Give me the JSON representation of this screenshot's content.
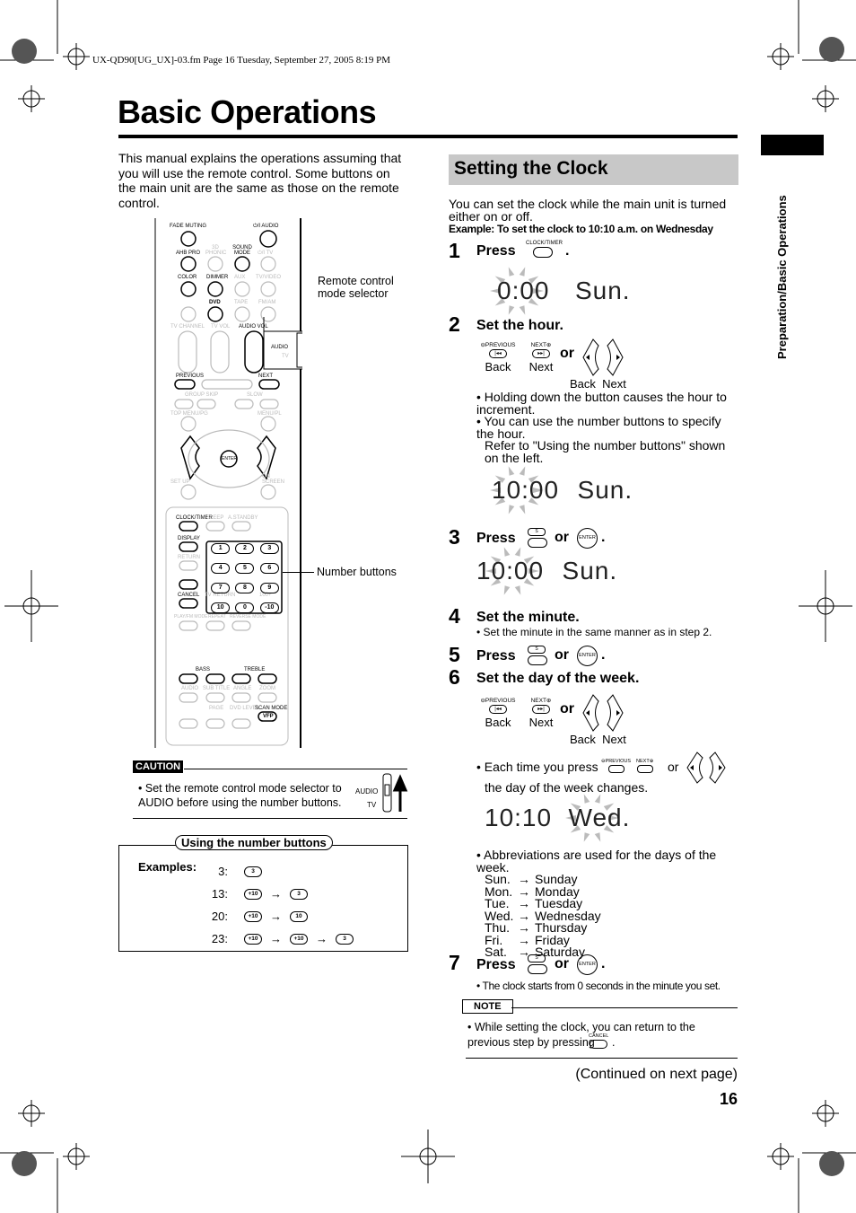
{
  "file_header": "UX-QD90[UG_UX]-03.fm  Page 16  Tuesday, September 27, 2005  8:19 PM",
  "page_title": "Basic Operations",
  "side_tab": "Preparation/Basic Operations",
  "intro": "This manual explains the operations assuming that you will use the remote control. Some buttons on the main unit are the same as those on the remote control.",
  "remote": {
    "callout_mode_selector": "Remote control mode selector",
    "callout_number_buttons": "Number buttons",
    "labels": {
      "fade_muting": "FADE MUTING",
      "power_audio": "⏻/I AUDIO",
      "ahb_pro": "AHB PRO",
      "phonic": "3D PHONIC",
      "sound_mode": "SOUND MODE",
      "power_tv": "⏻/I TV",
      "color": "COLOR",
      "dimmer": "DIMMER",
      "aux": "AUX",
      "tv_video": "TV/VIDEO",
      "dvd": "DVD",
      "tape": "TAPE",
      "fm_am": "FM/AM",
      "tv_channel": "TV CHANNEL",
      "tv_vol": "TV VOL",
      "audio_vol": "AUDIO VOL",
      "audio": "AUDIO",
      "tv": "TV",
      "previous": "PREVIOUS",
      "next": "NEXT",
      "group_skip": "GROUP SKIP",
      "slow": "SLOW",
      "top_menu": "TOP MENU/PG",
      "menu_pl": "MENU/PL",
      "enter": "ENTER",
      "set_up": "SET UP",
      "on_screen": "ON SCREEN",
      "clock_timer": "CLOCK/TIMER",
      "sleep": "SLEEP",
      "a_standby": "A.STANDBY",
      "display": "DISPLAY",
      "return": "RETURN",
      "cancel": "CANCEL",
      "tv_return": "TV RETURN",
      "hundred_plus": "100+",
      "play_mode": "PLAY/FM MODE",
      "repeat": "REPEAT",
      "reverse_mode": "REVERSE MODE",
      "bass": "BASS",
      "treble": "TREBLE",
      "audio2": "AUDIO",
      "sub_title": "SUB TITLE",
      "angle": "ANGLE",
      "zoom": "ZOOM",
      "page": "PAGE",
      "dvd_level": "DVD LEVEL",
      "scan_mode": "SCAN MODE",
      "vfp": "VFP"
    },
    "number_keys": [
      "1",
      "2",
      "3",
      "4",
      "5",
      "6",
      "7",
      "8",
      "9",
      "10",
      "0",
      "-10"
    ]
  },
  "caution": {
    "label": "CAUTION",
    "text": "Set the remote control mode selector to AUDIO before using the number buttons.",
    "audio": "AUDIO",
    "tv": "TV"
  },
  "number_box": {
    "title": "Using the number buttons",
    "examples_label": "Examples",
    "rows": [
      {
        "value": "3:",
        "keys": [
          "3"
        ]
      },
      {
        "value": "13:",
        "keys": [
          "+10",
          "3"
        ]
      },
      {
        "value": "20:",
        "keys": [
          "+10",
          "10"
        ]
      },
      {
        "value": "23:",
        "keys": [
          "+10",
          "+10",
          "3"
        ]
      }
    ],
    "arrow": "→"
  },
  "section": {
    "title": "Setting the Clock",
    "intro": "You can set the clock while the main unit is turned either on or off.",
    "example": "Example: To set the clock to 10:10 a.m. on Wednesday",
    "or": "or",
    "back": "Back",
    "next": "Next",
    "steps": [
      {
        "num": "1",
        "text": "Press",
        "button": "CLOCK/TIMER",
        "display": {
          "time": "0:00",
          "day": "Sun."
        }
      },
      {
        "num": "2",
        "text": "Set the hour.",
        "bullets": [
          "Holding down the button causes the hour to increment.",
          "You can use the number buttons to specify the hour.",
          "Refer to \"Using the number buttons\" shown on the left."
        ],
        "display": {
          "time": "10:00",
          "day": "Sun."
        }
      },
      {
        "num": "3",
        "text": "Press",
        "display": {
          "time": "10:00",
          "day": "Sun."
        }
      },
      {
        "num": "4",
        "text": "Set the minute.",
        "bullet": "Set the minute in the same manner as in step 2."
      },
      {
        "num": "5",
        "text": "Press"
      },
      {
        "num": "6",
        "text": "Set the day of the week.",
        "bullet_a": "Each time you press",
        "bullet_b": "the day of the week changes.",
        "display": {
          "time": "10:10",
          "day": "Wed."
        },
        "abbr_intro": "Abbreviations are used for the days of the week.",
        "abbr": [
          [
            "Sun.",
            "Sunday"
          ],
          [
            "Mon.",
            "Monday"
          ],
          [
            "Tue.",
            "Tuesday"
          ],
          [
            "Wed.",
            "Wednesday"
          ],
          [
            "Thu.",
            "Thursday"
          ],
          [
            "Fri.",
            "Friday"
          ],
          [
            "Sat.",
            "Saturday"
          ]
        ]
      },
      {
        "num": "7",
        "text": "Press",
        "bullet": "The clock starts from 0 seconds in the minute you set."
      }
    ],
    "note_label": "NOTE",
    "note_text": "While setting the clock, you can return to the previous step by pressing",
    "note_button": "CANCEL",
    "continued": "(Continued on next page)",
    "page_number": "16"
  }
}
